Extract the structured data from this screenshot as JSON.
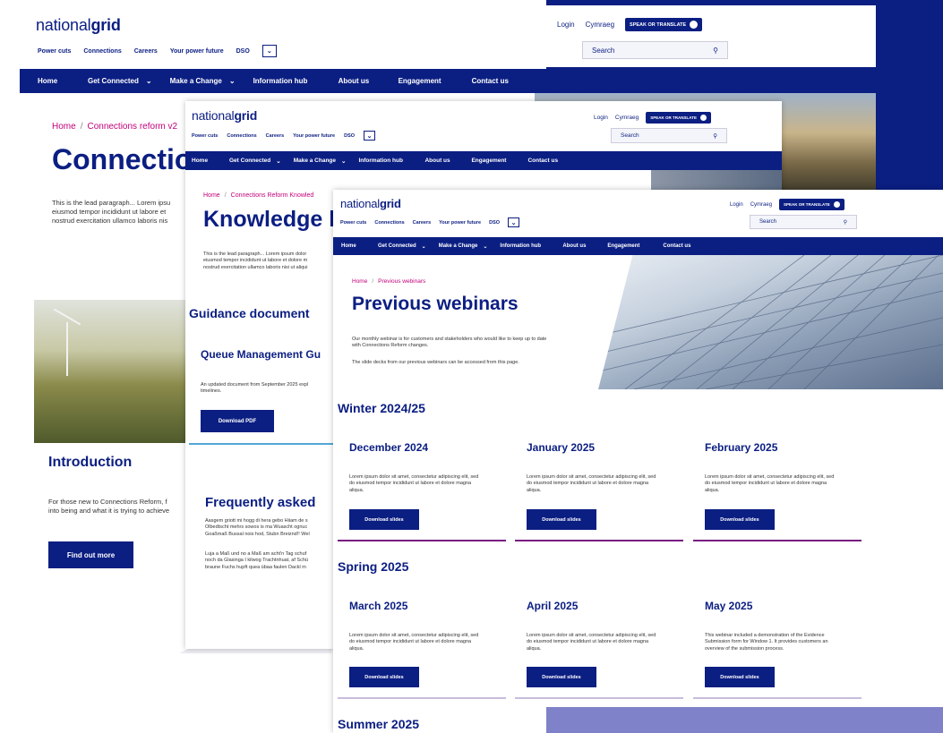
{
  "colors": {
    "navy": "#0b1e82",
    "magenta": "#c2007a",
    "lavender": "#7f82c8"
  },
  "brand": {
    "logo_light": "national",
    "logo_bold": "grid"
  },
  "utility": {
    "login": "Login",
    "language": "Cymraeg",
    "speak": "SPEAK OR TRANSLATE",
    "search_placeholder": "Search",
    "search_icon": "search-icon"
  },
  "quick_links": [
    "Power cuts",
    "Connections",
    "Careers",
    "Your power future",
    "DSO"
  ],
  "nav_items": [
    "Home",
    "Get Connected",
    "Make a Change",
    "Information hub",
    "About us",
    "Engagement",
    "Contact us"
  ],
  "back_page": {
    "crumb_home": "Home",
    "crumb_current": "Connections reform v2",
    "title": "Connectio",
    "lead": [
      "This is the lead paragraph... Lorem ipsu",
      "eiusmod tempor incididunt ut labore et",
      "nostrud exercitation ullamco laboris nis"
    ],
    "intro_title": "Introduction",
    "intro_text": [
      "For those new to Connections Reform, f",
      "into being and what it is trying to achieve"
    ],
    "find_out_more": "Find out more"
  },
  "mid_page": {
    "crumb_home": "Home",
    "crumb_current": "Connections Reform Knowled",
    "title": "Knowledge h",
    "lead": [
      "This is the lead paragraph... Lorem ipsum dolor",
      "eiusmod tempor incididunt ut labore et dolore m",
      "nostrud exercitation ullamco laboris nisi ut aliqui"
    ],
    "guidance_title": "Guidance document",
    "queue_title": "Queue Management Gu",
    "queue_text": [
      "An updated document from September 2025 expl",
      "timelines."
    ],
    "download_pdf": "Download PDF",
    "faq_title": "Frequently asked",
    "faq_text1": [
      "Aasgem griott mi hogg di hera gebo Hiiam de s",
      "Olbedtscht mehrs sowos is ma Wuascht ognuc",
      "Goaßmaß Bussal nois hod, Stubn Breiznd!! Wel"
    ],
    "faq_text2": [
      "Luja a Maß und no a Maß am acht'n Tag schuf",
      "noch da Glasinga I kilwog Trachtnhuat, af Schü",
      "braune Fuchs hupft quea übaa faulen Dackl m"
    ]
  },
  "front_page": {
    "crumb_home": "Home",
    "crumb_current": "Previous webinars",
    "title": "Previous webinars",
    "intro1": [
      "Our monthly webinar is for customers and stakeholders who would like to keep up to date",
      "with Connections Reform changes."
    ],
    "intro2": "The slide decks from our previous webinars can be accessed from this page.",
    "download_label": "Download slides",
    "lorem": [
      "Lorem ipsum dolor sit amet, consectetur adipiscing elit, sed",
      "do eiusmod tempor incididunt ut labore et dolore magna",
      "aliqua."
    ],
    "may_text": [
      "This webinar included a demonstration of the Evidence",
      "Submission form for Window 1. It provides customers an",
      "overview of the submission process."
    ],
    "seasons": [
      {
        "name": "Winter 2024/25",
        "months": [
          "December 2024",
          "January 2025",
          "February 2025"
        ]
      },
      {
        "name": "Spring 2025",
        "months": [
          "March 2025",
          "April 2025",
          "May 2025"
        ]
      },
      {
        "name": "Summer 2025",
        "months": []
      }
    ]
  }
}
